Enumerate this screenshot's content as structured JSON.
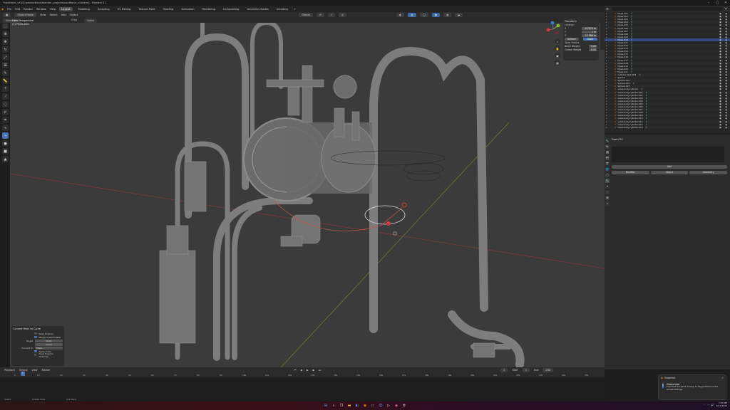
{
  "window": {
    "title": "*vaultland_v4 [D:\\productions\\blender_projects\\vaultland_v4.blend] - Blender 4.1"
  },
  "menu": {
    "items": [
      "File",
      "Edit",
      "Render",
      "Window",
      "Help"
    ],
    "workspaces": [
      "Layout",
      "Modeling",
      "Sculpting",
      "UV Editing",
      "Texture Paint",
      "Shading",
      "Animation",
      "Rendering",
      "Compositing",
      "Geometry Nodes",
      "Scripting"
    ],
    "active_workspace": "Layout",
    "scene": "Scene",
    "view_layer": "ViewLayer"
  },
  "viewport_header": {
    "mode": "Object Mode",
    "items": [
      "View",
      "Select",
      "Add",
      "Object"
    ],
    "orientation": "Global",
    "snap": "Global",
    "drag": "Drag",
    "select_box": "Select Box",
    "options": "Options"
  },
  "viewport_info": {
    "line1": "User Perspective",
    "line2": "(1) Pipes.010"
  },
  "npanel": {
    "title": "Transform",
    "header": "Location",
    "rows": [
      {
        "label": "X",
        "value": "-0.2074 m"
      },
      {
        "label": "Y",
        "value": "1 m"
      },
      {
        "label": "Z",
        "value": "0.1986 m"
      }
    ],
    "buttons": [
      "Uniform",
      "Scale"
    ],
    "subheader": "Taper Radius",
    "rows2": [
      {
        "label": "Bevel Weight",
        "value": "0.00"
      },
      {
        "label": "Crease Weight",
        "value": "0.00"
      }
    ]
  },
  "last_operator": {
    "title": "Convert Mesh to Curve",
    "checkboxes": [
      {
        "label": "Keep Original",
        "on": false
      },
      {
        "label": "Merge Customizable",
        "on": true
      }
    ],
    "target": [
      "Mesh",
      "Curve"
    ],
    "target_label": "Target",
    "convert_label": "Convert to",
    "convert_value": "Mesh",
    "checks2": [
      {
        "label": "Apply Scale",
        "on": true
      },
      {
        "label": "Keep Original Ordering",
        "on": false
      }
    ]
  },
  "outliner": {
    "header_search": "",
    "rows": [
      {
        "name": "Pipes.001",
        "mod": "⚲",
        "sel": false
      },
      {
        "name": "Pipes.002",
        "mod": "⚲",
        "sel": false
      },
      {
        "name": "Pipes.003",
        "mod": "⚲",
        "sel": false
      },
      {
        "name": "Pipes.004",
        "mod": "⚲",
        "sel": false
      },
      {
        "name": "Pipes.005",
        "mod": "⚲",
        "sel": false
      },
      {
        "name": "Pipes.006",
        "mod": "⚲",
        "sel": false
      },
      {
        "name": "Pipes.007",
        "mod": "⚲",
        "sel": false
      },
      {
        "name": "Pipes.008",
        "mod": "⚲",
        "sel": false
      },
      {
        "name": "Pipes.009",
        "mod": "⚲",
        "sel": false
      },
      {
        "name": "Pipes.010",
        "mod": "⚲",
        "sel": true
      },
      {
        "name": "Pipes.011",
        "mod": "⚲",
        "sel": false
      },
      {
        "name": "Pipes.012",
        "mod": "⚲",
        "sel": false
      },
      {
        "name": "Pipes.013",
        "mod": "⚲",
        "sel": false
      },
      {
        "name": "Pipes.014",
        "mod": "⚲",
        "sel": false
      },
      {
        "name": "Pipes.015",
        "mod": "⚲",
        "sel": false
      },
      {
        "name": "Pipes.016",
        "mod": "⚲",
        "sel": false
      },
      {
        "name": "Pipes.017",
        "mod": "⚲",
        "sel": false
      },
      {
        "name": "Pipes.018",
        "mod": "⚲",
        "sel": false
      },
      {
        "name": "Pipes.019",
        "mod": "⚲",
        "sel": false
      },
      {
        "name": "Pipes.020",
        "mod": "⚲",
        "sel": false
      },
      {
        "name": "Pipes.021",
        "mod": "⚲",
        "sel": false
      },
      {
        "name": "cylinder.tank.002",
        "mod": "⚲",
        "sel": false
      },
      {
        "name": "Sphere",
        "mod": "",
        "sel": false
      },
      {
        "name": "Sphere.001",
        "mod": "",
        "sel": false
      },
      {
        "name": "Sphere.002",
        "mod": "⚲",
        "sel": false
      },
      {
        "name": "Sphere.003",
        "mod": "",
        "sel": false
      },
      {
        "name": "valve.body.cylinder",
        "mod": "⚲",
        "sel": false
      },
      {
        "name": "valve.body.cylinder.001",
        "mod": "⚲",
        "sel": false
      },
      {
        "name": "valve.body.cylinder.002",
        "mod": "⚲",
        "sel": false
      },
      {
        "name": "valve.body.cylinder.003",
        "mod": "⚲",
        "sel": false
      },
      {
        "name": "valve.body.cylinder.004",
        "mod": "⚲",
        "sel": false
      },
      {
        "name": "valve.body.cylinder.005",
        "mod": "⚲",
        "sel": false
      },
      {
        "name": "valve.body.cylinder.006",
        "mod": "⚲",
        "sel": false
      },
      {
        "name": "valve.body.cylinder.007",
        "mod": "⚲",
        "sel": false
      },
      {
        "name": "valve.body.cylinder.008",
        "mod": "⚲",
        "sel": false
      },
      {
        "name": "valve.body.cylinder.009",
        "mod": "⚲",
        "sel": false
      },
      {
        "name": "valve.body.cylinder.010",
        "mod": "⚲",
        "sel": false
      },
      {
        "name": "valve.body.cylinder.011",
        "mod": "⚲",
        "sel": false
      },
      {
        "name": "valve.body.cylinder.012",
        "mod": "⚲",
        "sel": false
      },
      {
        "name": "valve.body.cylinder.013",
        "mod": "⚲",
        "sel": false
      }
    ]
  },
  "properties": {
    "object_name": "Pipes.010",
    "add_button": "Add",
    "buttons": [
      "Modifier",
      "Object",
      "Geometry"
    ]
  },
  "timeline": {
    "menus": [
      "Playback",
      "Keying",
      "View",
      "Marker"
    ],
    "current_frame": "1",
    "start_label": "Start",
    "start": "1",
    "end_label": "End",
    "end": "250",
    "ticks": [
      "0",
      "10",
      "20",
      "30",
      "40",
      "50",
      "60",
      "70",
      "80",
      "90",
      "100",
      "110",
      "120",
      "130",
      "140",
      "150",
      "160",
      "170",
      "180",
      "190",
      "200",
      "210",
      "220",
      "230",
      "240",
      "250"
    ]
  },
  "statusbar": {
    "items": [
      "Select",
      "Rotate View",
      "Set Menu"
    ]
  },
  "toast": {
    "app": "Snapshot",
    "title": "Grammrod",
    "body": "Exported the Sewe directly to Heg preference the sunset settings."
  },
  "taskbar": {
    "time": "7:04 PM",
    "date": "5/11/2024",
    "colors": {
      "accent": "#4772b3",
      "selection": "#334d80",
      "object_orange": "#e08a30",
      "modifier_cyan": "#5bb7c4"
    }
  }
}
